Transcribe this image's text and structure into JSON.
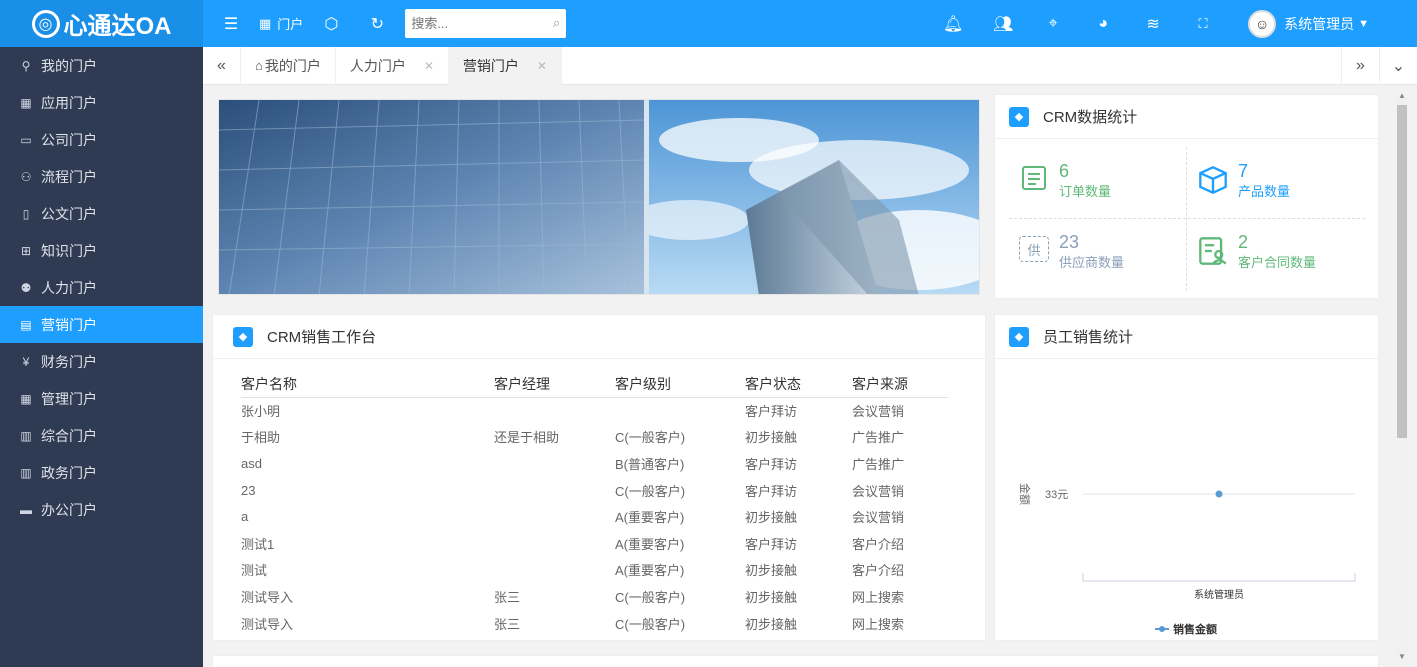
{
  "app": {
    "logo_text": "心通达OA",
    "logo_glyph": "⓪"
  },
  "topbar": {
    "portal_label": "门户",
    "search_placeholder": "搜索...",
    "username": "系统管理员"
  },
  "sidebar": {
    "items": [
      {
        "label": "我的门户",
        "icon": "user-icon"
      },
      {
        "label": "应用门户",
        "icon": "apps-icon"
      },
      {
        "label": "公司门户",
        "icon": "building-icon"
      },
      {
        "label": "流程门户",
        "icon": "users-icon"
      },
      {
        "label": "公文门户",
        "icon": "document-icon"
      },
      {
        "label": "知识门户",
        "icon": "book-icon"
      },
      {
        "label": "人力门户",
        "icon": "people-icon"
      },
      {
        "label": "营销门户",
        "icon": "calendar-icon"
      },
      {
        "label": "财务门户",
        "icon": "yen-icon"
      },
      {
        "label": "管理门户",
        "icon": "grid-icon"
      },
      {
        "label": "综合门户",
        "icon": "columns-icon"
      },
      {
        "label": "政务门户",
        "icon": "columns-icon"
      },
      {
        "label": "办公门户",
        "icon": "box-icon"
      }
    ]
  },
  "tabs": [
    {
      "label": "我的门户",
      "closable": false
    },
    {
      "label": "人力门户",
      "closable": true
    },
    {
      "label": "营销门户",
      "closable": true,
      "active": true
    }
  ],
  "crm_stats": {
    "title": "CRM数据统计",
    "items": [
      {
        "value": "6",
        "label": "订单数量",
        "color": "#5fb878"
      },
      {
        "value": "7",
        "label": "产品数量",
        "color": "#1e9fff"
      },
      {
        "value": "23",
        "label": "供应商数量",
        "color": "#8aa0b8"
      },
      {
        "value": "2",
        "label": "客户合同数量",
        "color": "#5fb878"
      }
    ]
  },
  "sales_table": {
    "title": "CRM销售工作台",
    "columns": [
      "客户名称",
      "客户经理",
      "客户级别",
      "客户状态",
      "客户来源"
    ],
    "rows": [
      [
        "张小明",
        "",
        "",
        "客户拜访",
        "会议营销"
      ],
      [
        "于相助",
        "还是于相助",
        "C(一般客户)",
        "初步接触",
        "广告推广"
      ],
      [
        "asd",
        "",
        "B(普通客户)",
        "客户拜访",
        "广告推广"
      ],
      [
        "23",
        "",
        "C(一般客户)",
        "客户拜访",
        "会议营销"
      ],
      [
        "a",
        "",
        "A(重要客户)",
        "初步接触",
        "会议营销"
      ],
      [
        "测试1",
        "",
        "A(重要客户)",
        "客户拜访",
        "客户介绍"
      ],
      [
        "测试",
        "",
        "A(重要客户)",
        "初步接触",
        "客户介绍"
      ],
      [
        "测试导入",
        "张三",
        "C(一般客户)",
        "初步接触",
        "网上搜索"
      ],
      [
        "测试导入",
        "张三",
        "C(一般客户)",
        "初步接触",
        "网上搜索"
      ]
    ]
  },
  "employee_chart": {
    "title": "员工销售统计",
    "chart_data": {
      "type": "line",
      "categories": [
        "系统管理员"
      ],
      "series": [
        {
          "name": "销售金额",
          "values": [
            33
          ]
        }
      ],
      "ylabel": "金额",
      "tick_labels": [
        "33元"
      ]
    }
  }
}
